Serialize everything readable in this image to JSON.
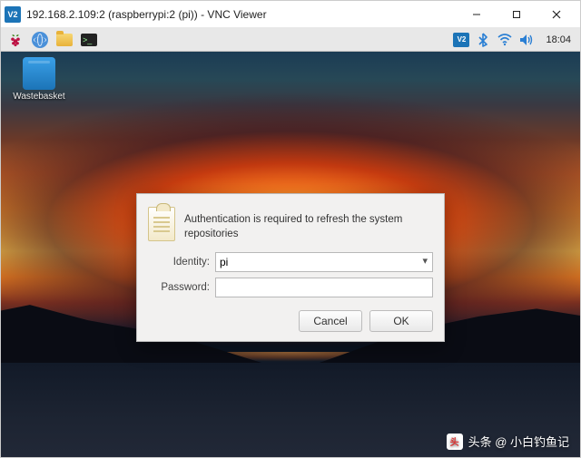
{
  "window": {
    "title": "192.168.2.109:2 (raspberrypi:2 (pi)) - VNC Viewer",
    "app_badge": "V2"
  },
  "taskbar": {
    "clock": "18:04",
    "tray_vnc": "V2"
  },
  "desktop": {
    "wastebasket_label": "Wastebasket"
  },
  "dialog": {
    "message": "Authentication is required to refresh the system repositories",
    "identity_label": "Identity:",
    "identity_value": "pi",
    "password_label": "Password:",
    "password_value": "",
    "cancel": "Cancel",
    "ok": "OK"
  },
  "watermark": {
    "logo_text": "头",
    "text": "头条 @ 小白钓鱼记"
  }
}
